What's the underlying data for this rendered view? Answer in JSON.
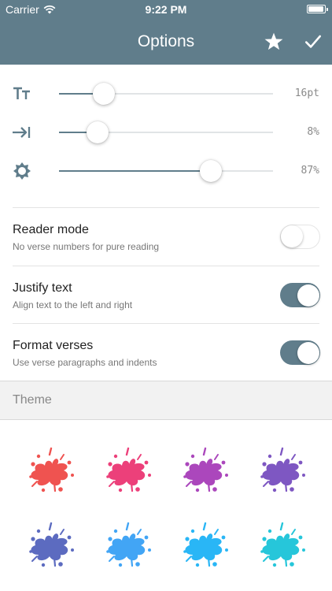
{
  "status_bar": {
    "carrier": "Carrier",
    "time": "9:22 PM",
    "battery_level": 0.95
  },
  "nav": {
    "title": "Options",
    "icons": [
      "star-icon",
      "checkmark-icon"
    ]
  },
  "sliders": [
    {
      "name": "font-size",
      "icon": "text-size-icon",
      "value_label": "16pt",
      "level": 0.21
    },
    {
      "name": "indent",
      "icon": "indent-icon",
      "value_label": "8%",
      "level": 0.18
    },
    {
      "name": "brightness",
      "icon": "brightness-icon",
      "value_label": "87%",
      "level": 0.71
    }
  ],
  "toggles": [
    {
      "label": "Reader mode",
      "subtitle": "No verse numbers for pure reading",
      "on": false
    },
    {
      "label": "Justify text",
      "subtitle": "Align text to the left and right",
      "on": true
    },
    {
      "label": "Format verses",
      "subtitle": "Use verse paragraphs and indents",
      "on": true
    }
  ],
  "theme": {
    "header": "Theme",
    "colors": [
      "#ef5350",
      "#ec407a",
      "#ab47bc",
      "#7e57c2",
      "#5c6bc0",
      "#42a5f5",
      "#29b6f6",
      "#26c6da"
    ]
  },
  "accent_color": "#607d8b"
}
